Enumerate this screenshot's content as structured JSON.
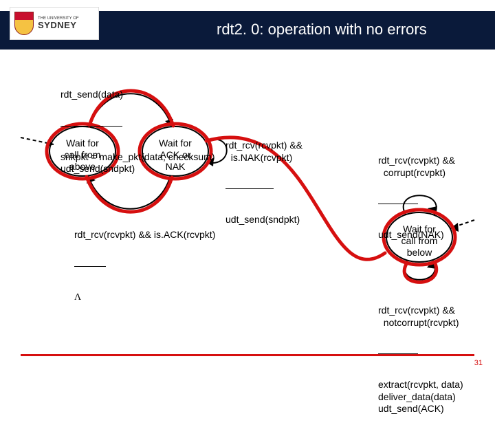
{
  "header": {
    "uni_small": "THE UNIVERSITY OF",
    "uni_big": "SYDNEY",
    "title": "rdt2. 0: operation with no errors"
  },
  "states": {
    "s1": "Wait for\ncall from\nabove",
    "s2": "Wait for\nACK or\nNAK",
    "s3": "Wait for\ncall from\nbelow"
  },
  "labels": {
    "send_top": "rdt_send(data)",
    "send_mid": "snkpkt = make_pkt(data, checksum)\nudt_send(sndpkt)",
    "nak_cond": "rdt_rcv(rcvpkt) &&\n  is.NAK(rcvpkt)",
    "nak_action": "udt_send(sndpkt)",
    "ack_cond": "rdt_rcv(rcvpkt) && is.ACK(rcvpkt)",
    "ack_lambda": "Λ",
    "corrupt_cond": "rdt_rcv(rcvpkt) &&\n  corrupt(rcvpkt)",
    "corrupt_action": "udt_send(NAK)",
    "ok_cond": "rdt_rcv(rcvpkt) &&\n  notcorrupt(rcvpkt)",
    "ok_action": "extract(rcvpkt, data)\ndeliver_data(data)\nudt_send(ACK)"
  },
  "page_number": "31"
}
